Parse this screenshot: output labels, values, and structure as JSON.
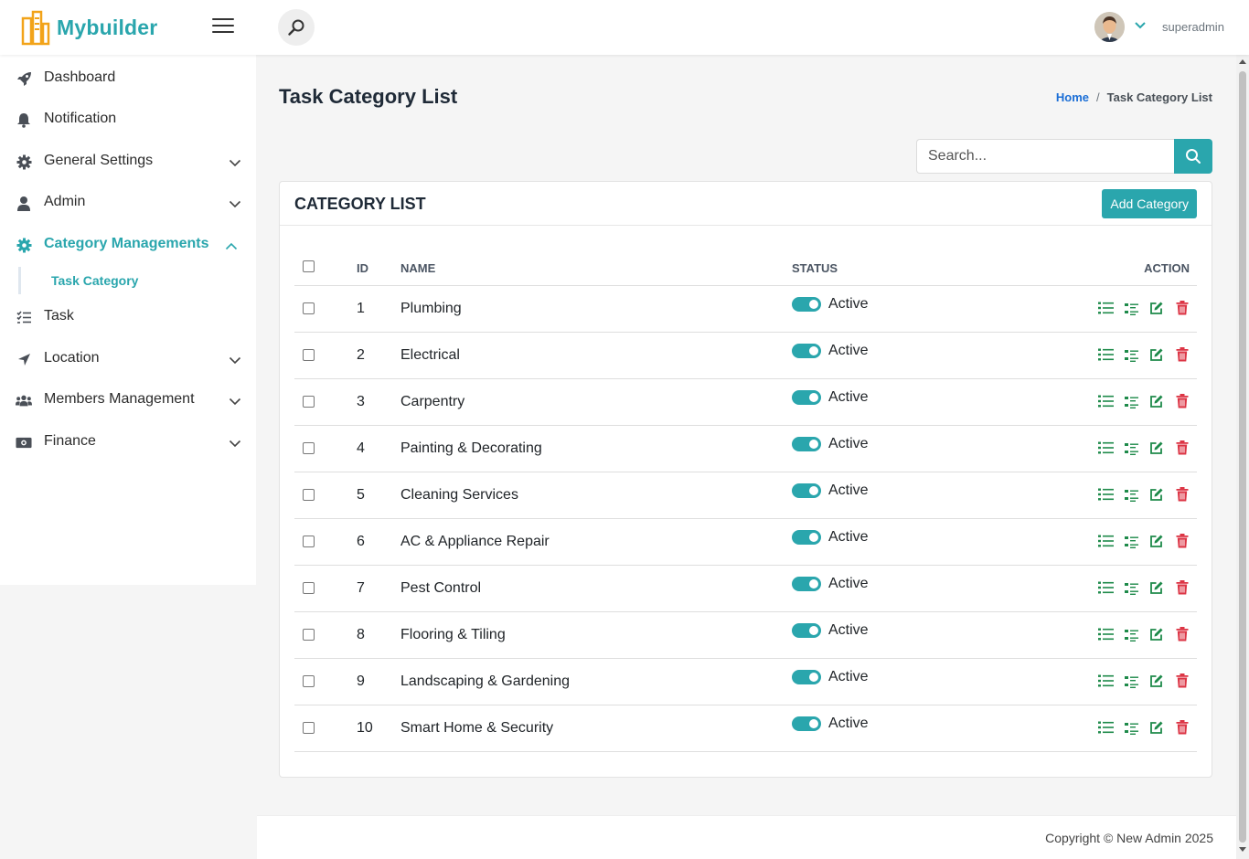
{
  "app": {
    "name": "Mybuilder",
    "user": "superadmin"
  },
  "sidebar": {
    "items": [
      {
        "label": "Dashboard",
        "icon": "rocket-icon"
      },
      {
        "label": "Notification",
        "icon": "bell-icon"
      },
      {
        "label": "General Settings",
        "icon": "gear-icon",
        "expandable": true
      },
      {
        "label": "Admin",
        "icon": "user-icon",
        "expandable": true
      },
      {
        "label": "Category Managements",
        "icon": "gear-icon",
        "expandable": true,
        "expanded": true,
        "active": true
      },
      {
        "label": "Task",
        "icon": "task-list-icon"
      },
      {
        "label": "Location",
        "icon": "location-arrow-icon",
        "expandable": true
      },
      {
        "label": "Members Management",
        "icon": "users-icon",
        "expandable": true
      },
      {
        "label": "Finance",
        "icon": "money-icon",
        "expandable": true
      }
    ],
    "subitem": {
      "label": "Task Category"
    }
  },
  "page": {
    "title": "Task Category List",
    "breadcrumb": {
      "home": "Home",
      "separator": "/",
      "current": "Task Category List"
    }
  },
  "search": {
    "placeholder": "Search..."
  },
  "card": {
    "title": "CATEGORY LIST",
    "add_label": "Add Category"
  },
  "table": {
    "headers": {
      "id": "ID",
      "name": "NAME",
      "status": "STATUS",
      "action": "ACTION"
    },
    "rows": [
      {
        "id": "1",
        "name": "Plumbing",
        "status": "Active"
      },
      {
        "id": "2",
        "name": "Electrical",
        "status": "Active"
      },
      {
        "id": "3",
        "name": "Carpentry",
        "status": "Active"
      },
      {
        "id": "4",
        "name": "Painting & Decorating",
        "status": "Active"
      },
      {
        "id": "5",
        "name": "Cleaning Services",
        "status": "Active"
      },
      {
        "id": "6",
        "name": "AC & Appliance Repair",
        "status": "Active"
      },
      {
        "id": "7",
        "name": "Pest Control",
        "status": "Active"
      },
      {
        "id": "8",
        "name": "Flooring & Tiling",
        "status": "Active"
      },
      {
        "id": "9",
        "name": "Landscaping & Gardening",
        "status": "Active"
      },
      {
        "id": "10",
        "name": "Smart Home & Security",
        "status": "Active"
      }
    ]
  },
  "footer": {
    "text": "Copyright © New Admin 2025"
  },
  "colors": {
    "accent": "#2aa6ad",
    "link": "#1b6ed6",
    "action_green": "#1e8a4a",
    "delete_red": "#dc3545"
  }
}
